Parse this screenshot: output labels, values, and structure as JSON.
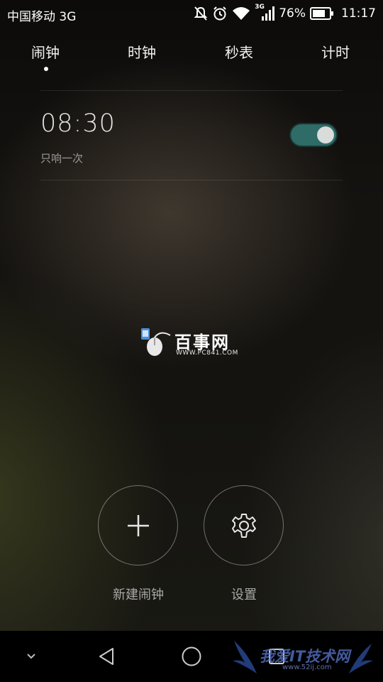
{
  "status_bar": {
    "carrier": "中国移动 3G",
    "network_badge": "3G",
    "battery_percent": "76%",
    "time": "11:17",
    "icons": [
      "mute-icon",
      "alarm-icon",
      "wifi-icon",
      "signal-icon",
      "battery-icon"
    ]
  },
  "tabs": [
    {
      "label": "闹钟",
      "active": true
    },
    {
      "label": "时钟",
      "active": false
    },
    {
      "label": "秒表",
      "active": false
    },
    {
      "label": "计时",
      "active": false
    }
  ],
  "alarms": [
    {
      "time": "08:30",
      "repeat": "只响一次",
      "enabled": true
    }
  ],
  "actions": {
    "new_alarm_label": "新建闹钟",
    "settings_label": "设置"
  },
  "watermark": {
    "name": "百事网",
    "url": "WWW.PC841.COM"
  },
  "corner_watermark": {
    "name": "我爱IT技术网",
    "url": "www.52ij.com"
  },
  "colors": {
    "toggle_on": "#2f6b67",
    "background": "#141310"
  }
}
